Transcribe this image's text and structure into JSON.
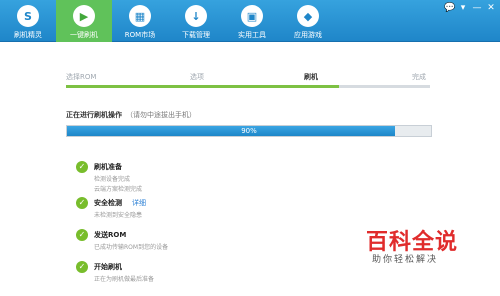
{
  "toolbar": {
    "items": [
      {
        "label": "刷机精灵",
        "icon": "S"
      },
      {
        "label": "一键刷机",
        "icon": "▶"
      },
      {
        "label": "ROM市场",
        "icon": "▦"
      },
      {
        "label": "下载管理",
        "icon": "↓"
      },
      {
        "label": "实用工具",
        "icon": "▣"
      },
      {
        "label": "应用游戏",
        "icon": "◆"
      }
    ],
    "active_index": 1,
    "window_controls": [
      "💬",
      "▾",
      "—",
      "✕"
    ]
  },
  "steps": {
    "items": [
      "选择ROM",
      "选项",
      "刷机",
      "完成"
    ],
    "current": 2,
    "progress": 0.75
  },
  "progress": {
    "title": "正在进行刷机操作",
    "hint": "（请勿中途拔出手机）",
    "value": 0.9,
    "text": "90%",
    "color": "#2a92d6"
  },
  "tasks": [
    {
      "title": "刷机准备",
      "subs": [
        "检测设备完成",
        "云端方案检测完成"
      ]
    },
    {
      "title": "安全检测",
      "link": "详细",
      "subs": [
        "未检测到安全隐患"
      ]
    },
    {
      "title": "发送ROM",
      "subs": [
        "已成功传输ROM到您的设备"
      ]
    },
    {
      "title": "开始刷机",
      "subs": [
        "正在为刷机做最后准备"
      ]
    }
  ],
  "watermark": {
    "big": "百科全说",
    "small": "助你轻松解决"
  },
  "colors": {
    "toolbar": "#2a92d6",
    "active_tab": "#60c25a",
    "check": "#78bd2c",
    "watermark_red": "#e02c2c"
  }
}
